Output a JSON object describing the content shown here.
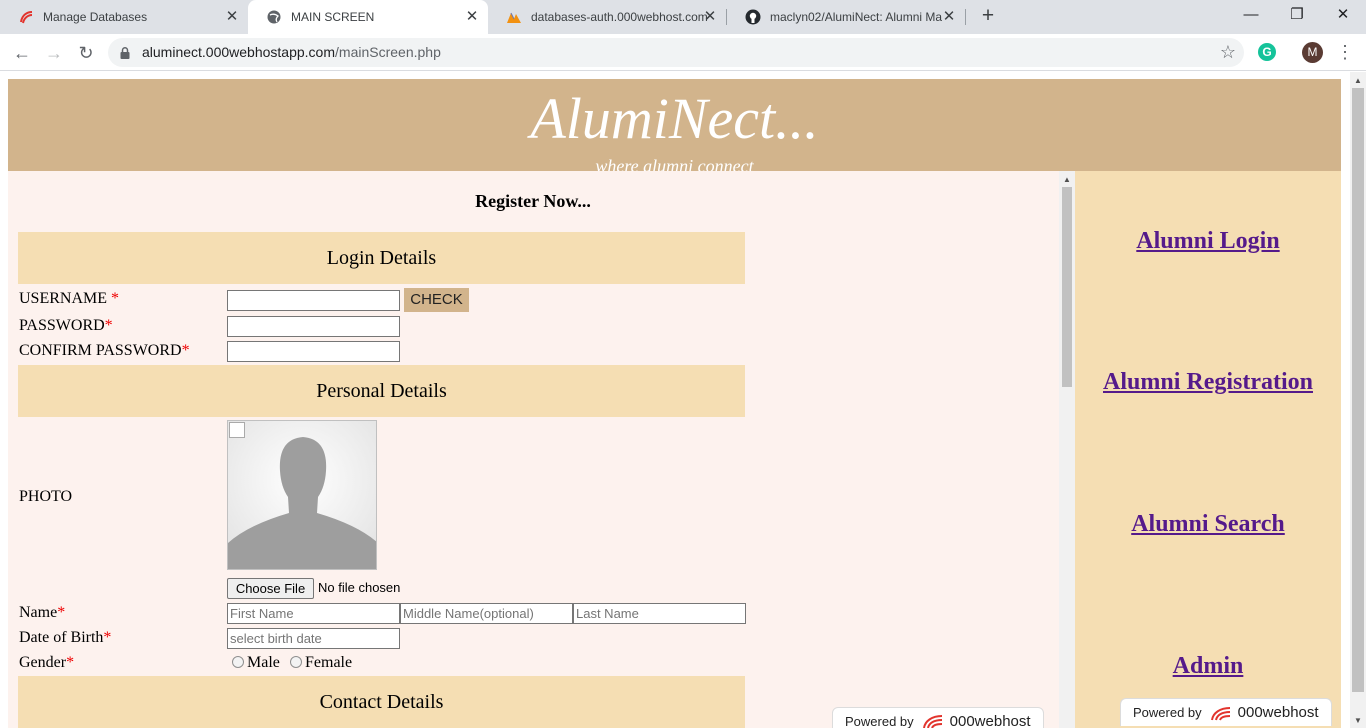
{
  "browser": {
    "tabs": [
      {
        "title": "Manage Databases",
        "icon": "000webhost-icon",
        "close": "✕"
      },
      {
        "title": "MAIN SCREEN",
        "icon": "globe-icon",
        "close": "✕"
      },
      {
        "title": "databases-auth.000webhost.com",
        "icon": "phpmyadmin-icon",
        "close": "✕"
      },
      {
        "title": "maclyn02/AlumiNect: Alumni Ma",
        "icon": "github-icon",
        "close": "✕"
      }
    ],
    "new_tab": "+",
    "window_controls": {
      "minimize": "—",
      "restore": "❐",
      "close": "✕"
    },
    "nav": {
      "back": "←",
      "forward": "→",
      "reload": "↻"
    },
    "url_host": "aluminect.000webhostapp.com",
    "url_path": "/mainScreen.php",
    "star": "☆",
    "extension_letter": "G",
    "profile_letter": "M",
    "menu": "⋮"
  },
  "site": {
    "title": "AlumiNect...",
    "tagline": "where alumni connect"
  },
  "form": {
    "heading": "Register Now...",
    "required_mark": "*",
    "login_section": "Login Details",
    "username_label": "USERNAME ",
    "password_label": "PASSWORD",
    "confirm_label": "CONFIRM PASSWORD",
    "check_button": "CHECK",
    "personal_section": "Personal Details",
    "photo_label": "PHOTO",
    "choose_file": "Choose File",
    "no_file": "No file chosen",
    "name_label": "Name",
    "first_name_ph": "First Name",
    "middle_name_ph": "Middle Name(optional)",
    "last_name_ph": "Last Name",
    "dob_label": "Date of Birth",
    "dob_ph": "select birth date",
    "gender_label": "Gender",
    "male": " Male",
    "female": " Female",
    "contact_section": "Contact Details"
  },
  "sidebar": {
    "links": [
      "Alumni Login",
      "Alumni Registration",
      "Alumni Search",
      "Admin"
    ]
  },
  "badge": {
    "powered_by": "Powered by",
    "brand": "000webhost"
  },
  "colors": {
    "header_bg": "#d2b48c",
    "sidebar_bg": "#f5deb3",
    "main_bg": "#fdf2ee",
    "link": "#551a8b",
    "required": "#e00000"
  }
}
